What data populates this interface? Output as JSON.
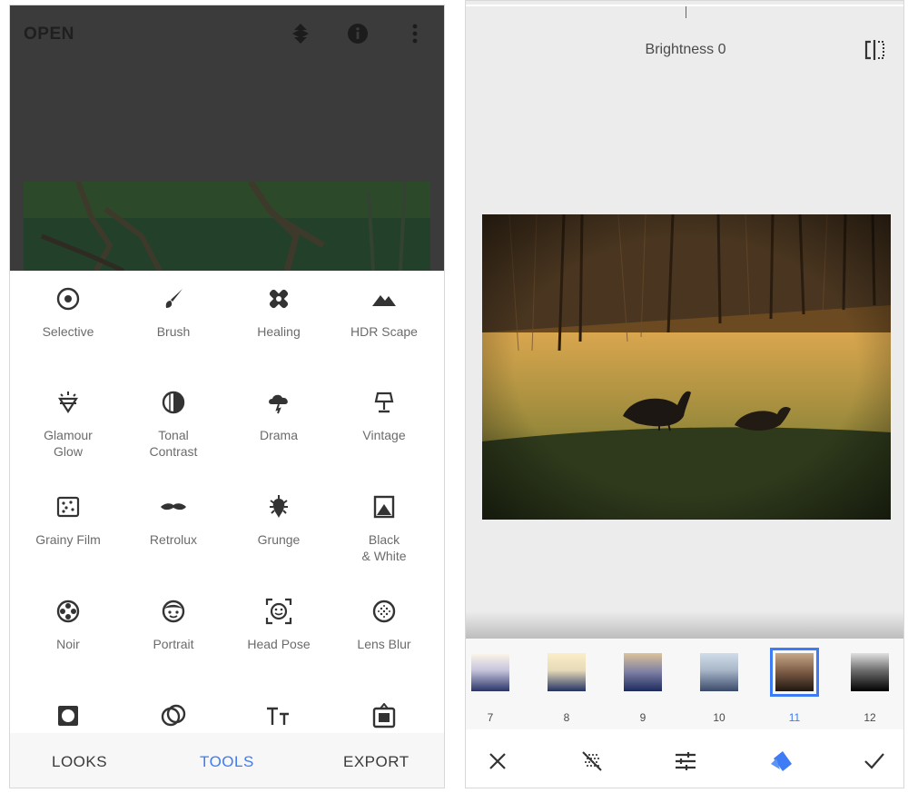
{
  "left": {
    "open_label": "OPEN",
    "tools": [
      {
        "label": "Selective",
        "icon": "selective-icon"
      },
      {
        "label": "Brush",
        "icon": "brush-icon"
      },
      {
        "label": "Healing",
        "icon": "healing-icon"
      },
      {
        "label": "HDR Scape",
        "icon": "hdr-scape-icon"
      },
      {
        "label": "Glamour\nGlow",
        "icon": "glamour-glow-icon"
      },
      {
        "label": "Tonal\nContrast",
        "icon": "tonal-contrast-icon"
      },
      {
        "label": "Drama",
        "icon": "drama-icon"
      },
      {
        "label": "Vintage",
        "icon": "vintage-icon"
      },
      {
        "label": "Grainy Film",
        "icon": "grainy-film-icon"
      },
      {
        "label": "Retrolux",
        "icon": "retrolux-icon"
      },
      {
        "label": "Grunge",
        "icon": "grunge-icon"
      },
      {
        "label": "Black\n& White",
        "icon": "black-white-icon"
      },
      {
        "label": "Noir",
        "icon": "noir-icon"
      },
      {
        "label": "Portrait",
        "icon": "portrait-icon"
      },
      {
        "label": "Head Pose",
        "icon": "head-pose-icon"
      },
      {
        "label": "Lens Blur",
        "icon": "lens-blur-icon"
      }
    ],
    "nav": {
      "looks": "LOOKS",
      "tools": "TOOLS",
      "export": "EXPORT"
    }
  },
  "right": {
    "brightness_label": "Brightness 0",
    "presets": [
      "7",
      "8",
      "9",
      "10",
      "11",
      "12"
    ],
    "selected_preset": "11"
  },
  "colors": {
    "accent": "#3d7cf4",
    "dark_bg": "#3b3b3b"
  }
}
